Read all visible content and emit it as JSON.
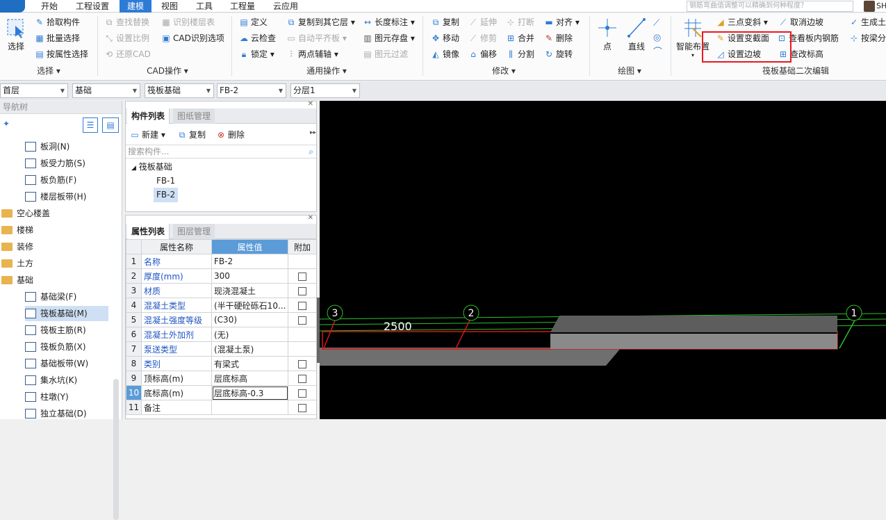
{
  "menu": {
    "items": [
      "开始",
      "工程设置",
      "建模",
      "视图",
      "工具",
      "工程量",
      "云应用"
    ],
    "active": 2
  },
  "search": {
    "placeholder": "钢筋弯曲值调整可以精确到何种程度？"
  },
  "user": "SH",
  "ribbon": {
    "select": {
      "big": "选择",
      "items": [
        "拾取构件",
        "批量选择",
        "按属性选择"
      ],
      "label": "选择 ▾"
    },
    "cad": {
      "items": [
        "查找替换",
        "识别楼层表",
        "设置比例",
        "CAD识别选项",
        "还原CAD"
      ],
      "label": "CAD操作 ▾"
    },
    "general": {
      "items": [
        "定义",
        "复制到其它层 ▾",
        "长度标注 ▾",
        "云检查",
        "自动平齐板 ▾",
        "图元存盘 ▾",
        "锁定 ▾",
        "两点辅轴 ▾",
        "图元过滤"
      ],
      "label": "通用操作 ▾"
    },
    "modify": {
      "items": [
        "复制",
        "延伸",
        "打断",
        "对齐 ▾",
        "移动",
        "修剪",
        "合并",
        "删除",
        "镜像",
        "偏移",
        "分割",
        "旋转"
      ],
      "label": "修改 ▾"
    },
    "draw": {
      "items": [
        "点",
        "直线"
      ],
      "label": "绘图 ▾"
    },
    "raft": {
      "smart": "智能布置",
      "items": [
        "三点变斜 ▾",
        "取消边坡",
        "生成土",
        "设置变截面",
        "查看板内钢筋",
        "按梁分",
        "设置边坡",
        "查改标高"
      ],
      "label": "筏板基础二次编辑"
    }
  },
  "dropdowns": [
    "首层",
    "基础",
    "筏板基础",
    "FB-2",
    "分层1"
  ],
  "nav": {
    "header": "导航树",
    "items": [
      {
        "label": "板洞(N)",
        "type": "item"
      },
      {
        "label": "板受力筋(S)",
        "type": "item"
      },
      {
        "label": "板负筋(F)",
        "type": "item"
      },
      {
        "label": "楼层板带(H)",
        "type": "item"
      },
      {
        "label": "空心楼盖",
        "type": "folder"
      },
      {
        "label": "楼梯",
        "type": "folder"
      },
      {
        "label": "装修",
        "type": "folder"
      },
      {
        "label": "土方",
        "type": "folder"
      },
      {
        "label": "基础",
        "type": "folder"
      },
      {
        "label": "基础梁(F)",
        "type": "item"
      },
      {
        "label": "筏板基础(M)",
        "type": "item",
        "selected": true
      },
      {
        "label": "筏板主筋(R)",
        "type": "item"
      },
      {
        "label": "筏板负筋(X)",
        "type": "item"
      },
      {
        "label": "基础板带(W)",
        "type": "item"
      },
      {
        "label": "集水坑(K)",
        "type": "item"
      },
      {
        "label": "柱墩(Y)",
        "type": "item"
      },
      {
        "label": "独立基础(D)",
        "type": "item"
      }
    ]
  },
  "component_panel": {
    "tabs": [
      "构件列表",
      "图纸管理"
    ],
    "new": "新建 ▾",
    "copy": "复制",
    "delete": "删除",
    "search_placeholder": "搜索构件...",
    "tree_root": "筏板基础",
    "items": [
      "FB-1",
      "FB-2"
    ],
    "selected": "FB-2"
  },
  "property_panel": {
    "tabs": [
      "属性列表",
      "图层管理"
    ],
    "headers": [
      "属性名称",
      "属性值",
      "附加"
    ],
    "rows": [
      {
        "n": "1",
        "name": "名称",
        "value": "FB-2",
        "cb": false,
        "blue": true
      },
      {
        "n": "2",
        "name": "厚度(mm)",
        "value": "300",
        "cb": true,
        "blue": true
      },
      {
        "n": "3",
        "name": "材质",
        "value": "现浇混凝土",
        "cb": true,
        "blue": true
      },
      {
        "n": "4",
        "name": "混凝土类型",
        "value": "(半干硬砼砾石10...",
        "cb": true,
        "blue": true
      },
      {
        "n": "5",
        "name": "混凝土强度等级",
        "value": "(C30)",
        "cb": true,
        "blue": true
      },
      {
        "n": "6",
        "name": "混凝土外加剂",
        "value": "(无)",
        "cb": false,
        "blue": true
      },
      {
        "n": "7",
        "name": "泵送类型",
        "value": "(混凝土泵)",
        "cb": false,
        "blue": true
      },
      {
        "n": "8",
        "name": "类别",
        "value": "有梁式",
        "cb": true,
        "blue": true
      },
      {
        "n": "9",
        "name": "顶标高(m)",
        "value": "层底标高",
        "cb": true,
        "blue": false
      },
      {
        "n": "10",
        "name": "底标高(m)",
        "value": "层底标高-0.3",
        "cb": true,
        "blue": false
      },
      {
        "n": "11",
        "name": "备注",
        "value": "",
        "cb": true,
        "blue": false
      }
    ]
  },
  "canvas": {
    "axes": [
      "3",
      "2",
      "1"
    ],
    "dimension": "2500"
  }
}
